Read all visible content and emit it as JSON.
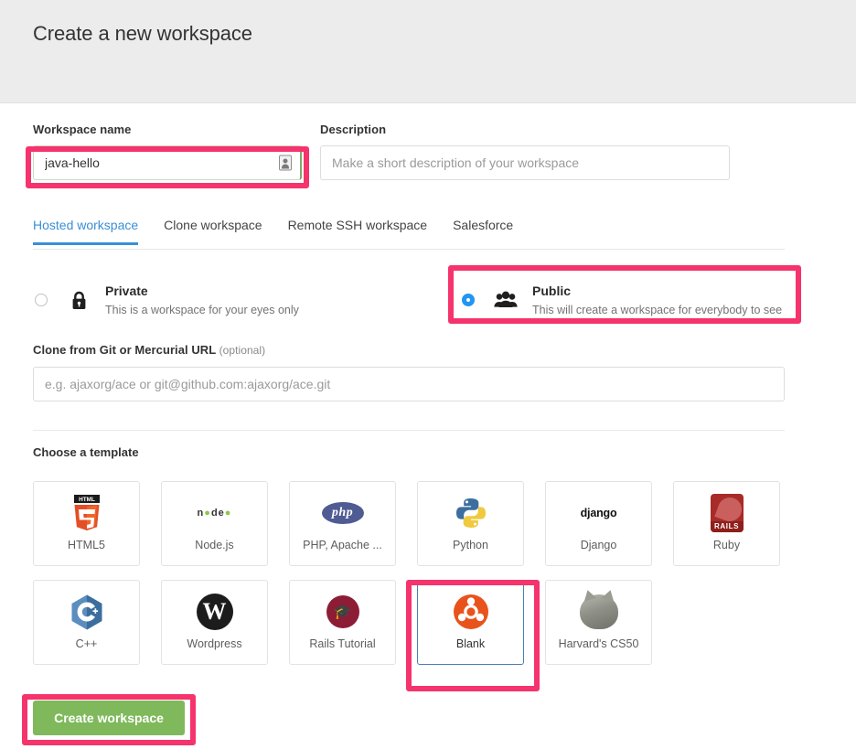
{
  "header": {
    "title": "Create a new workspace"
  },
  "form": {
    "name_label": "Workspace name",
    "name_value": "java-hello",
    "name_icon": "autofill-icon",
    "description_label": "Description",
    "description_value": "",
    "description_placeholder": "Make a short description of your workspace",
    "clone_label": "Clone from Git or Mercurial URL",
    "clone_optional": "(optional)",
    "clone_value": "",
    "clone_placeholder": "e.g. ajaxorg/ace or git@github.com:ajaxorg/ace.git",
    "choose_template_label": "Choose a template",
    "create_button": "Create workspace"
  },
  "tabs": [
    {
      "label": "Hosted workspace",
      "active": true
    },
    {
      "label": "Clone workspace",
      "active": false
    },
    {
      "label": "Remote SSH workspace",
      "active": false
    },
    {
      "label": "Salesforce",
      "active": false
    }
  ],
  "visibility": [
    {
      "key": "private",
      "title": "Private",
      "subtitle": "This is a workspace for your eyes only",
      "icon": "lock-icon",
      "selected": false
    },
    {
      "key": "public",
      "title": "Public",
      "subtitle": "This will create a workspace for everybody to see",
      "icon": "people-icon",
      "selected": true
    }
  ],
  "templates": [
    {
      "name": "HTML5",
      "logo": "html5-logo",
      "selected": false
    },
    {
      "name": "Node.js",
      "logo": "nodejs-logo",
      "selected": false
    },
    {
      "name": "PHP, Apache ...",
      "logo": "php-logo",
      "selected": false
    },
    {
      "name": "Python",
      "logo": "python-logo",
      "selected": false
    },
    {
      "name": "Django",
      "logo": "django-logo",
      "selected": false
    },
    {
      "name": "Ruby",
      "logo": "rails-logo",
      "selected": false
    },
    {
      "name": "C++",
      "logo": "cpp-logo",
      "selected": false
    },
    {
      "name": "Wordpress",
      "logo": "wordpress-logo",
      "selected": false
    },
    {
      "name": "Rails Tutorial",
      "logo": "rails-tutorial-logo",
      "selected": false
    },
    {
      "name": "Blank",
      "logo": "ubuntu-logo",
      "selected": true
    },
    {
      "name": "Harvard's CS50",
      "logo": "cs50-cat-logo",
      "selected": false
    }
  ],
  "colors": {
    "annotation": "#f5336d",
    "accent_tab": "#3a8fd6",
    "radio_selected": "#2196f3",
    "create_button": "#7fb95b",
    "header_band": "#ececec",
    "selected_card_border": "#4a7fb5"
  }
}
